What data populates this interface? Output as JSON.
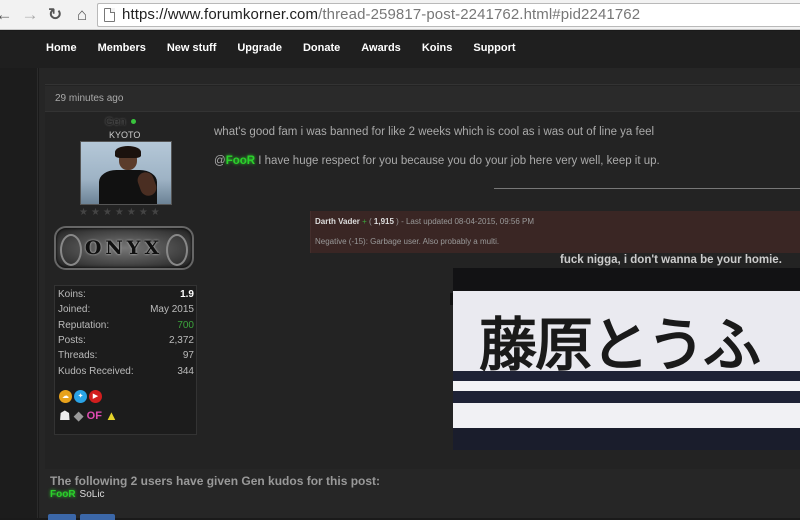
{
  "browser": {
    "url_prefix": "https://www.forumkorner.com",
    "url_rest": "/thread-259817-post-2241762.html#pid2241762"
  },
  "nav": {
    "items": [
      "Home",
      "Members",
      "New stuff",
      "Upgrade",
      "Donate",
      "Awards",
      "Koins",
      "Support"
    ]
  },
  "post": {
    "time": "29 minutes ago",
    "author": {
      "username": "Gen",
      "title": "KYOTO",
      "stars": "★★★★★★★",
      "rank": "ONYX"
    },
    "stats": [
      {
        "label": "Koins:",
        "value": "1.9"
      },
      {
        "label": "Joined:",
        "value": "May 2015"
      },
      {
        "label": "Reputation:",
        "value": "700"
      },
      {
        "label": "Posts:",
        "value": "2,372"
      },
      {
        "label": "Threads:",
        "value": "97"
      },
      {
        "label": "Kudos Received:",
        "value": "344"
      }
    ],
    "message_line1": "what's good fam i was banned for like 2 weeks which is cool as i was out of line ya feel",
    "mention_prefix": "@",
    "mention_name": "FooR",
    "message_line2_rest": " I have huge respect for you because you do your job here very well, keep it up.",
    "reputation_box": {
      "name": "Darth Vader",
      "count": "1,915",
      "updated": "Last updated 08-04-2015, 09:56 PM",
      "comment": "Negative (-15): Garbage user. Also probably a multi."
    },
    "signature_caption": "fuck nigga, i don't wanna be your homie.",
    "signature_text": "藤原とうふ"
  },
  "kudos": {
    "title": "The following 2 users have given Gen kudos for this post:",
    "user1": "FooR",
    "user2": "SoLic"
  },
  "colors": {
    "background": "#1a1a1a",
    "post_bg": "#232323",
    "mention_green": "#2bd12b",
    "rep_green": "#3ca53c",
    "negative_rep_bg": "#3a2624"
  }
}
